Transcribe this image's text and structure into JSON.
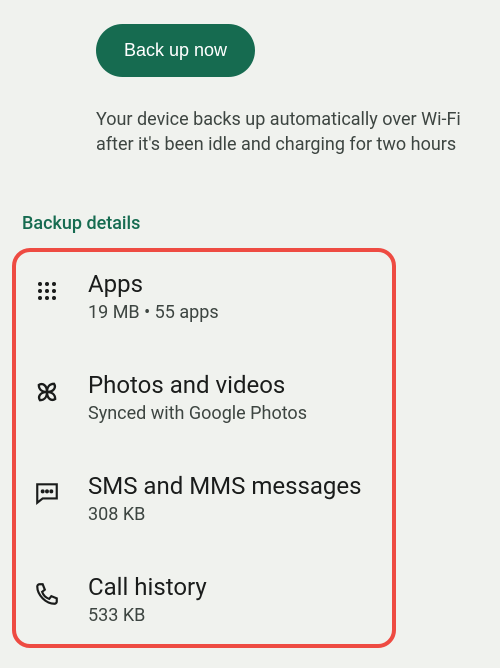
{
  "backup_button": "Back up now",
  "info_text": "Your device backs up automatically over Wi-Fi after it's been idle and charging for two hours",
  "section_header": "Backup details",
  "items": [
    {
      "title": "Apps",
      "subtitle": "19 MB • 55 apps"
    },
    {
      "title": "Photos and videos",
      "subtitle": "Synced with Google Photos"
    },
    {
      "title": "SMS and MMS messages",
      "subtitle": "308 KB"
    },
    {
      "title": "Call history",
      "subtitle": "533 KB"
    }
  ]
}
